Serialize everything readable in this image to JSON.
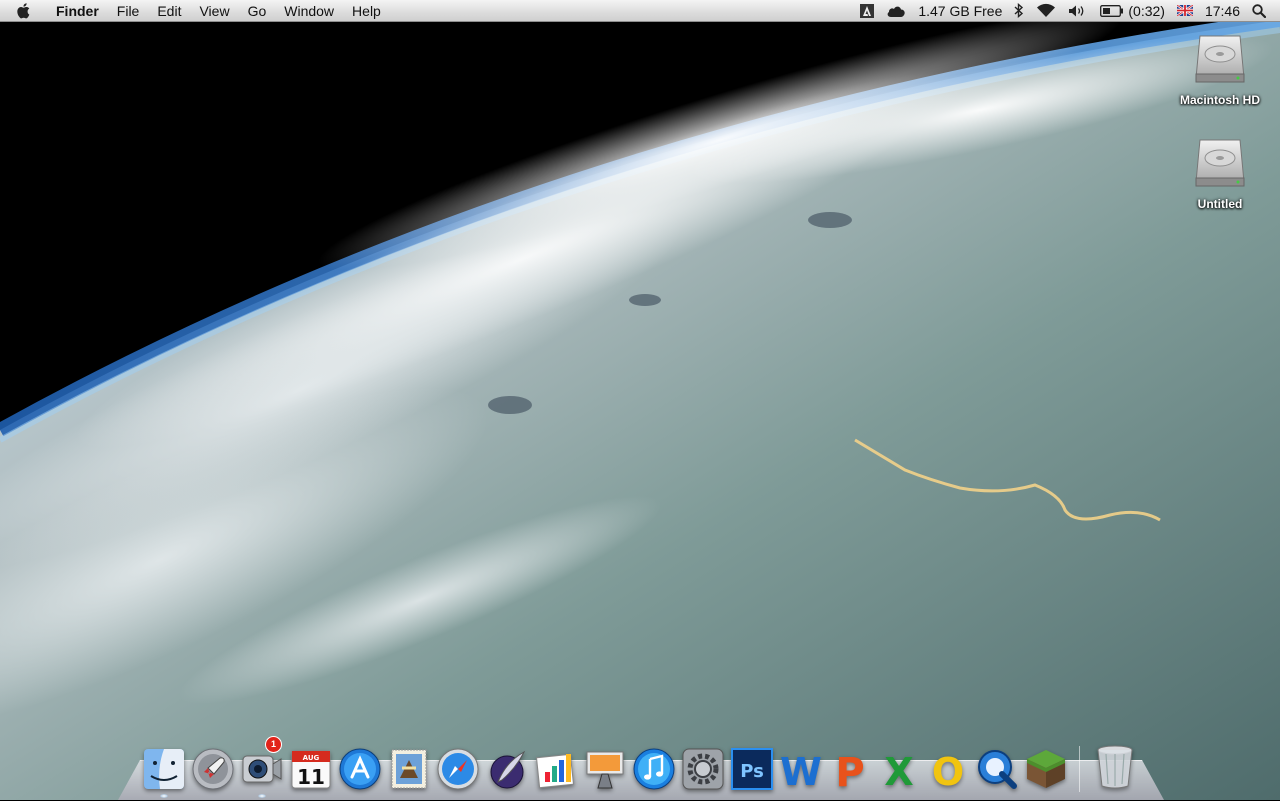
{
  "menubar": {
    "apple_icon": "apple-logo-icon",
    "app_name": "Finder",
    "menus": [
      "File",
      "Edit",
      "View",
      "Go",
      "Window",
      "Help"
    ],
    "status": {
      "adobe_icon": "adobe-icon",
      "icloud_icon": "cloud-icon",
      "disk_free": "1.47 GB Free",
      "bluetooth_icon": "bluetooth-icon",
      "wifi_icon": "wifi-icon",
      "volume_icon": "volume-icon",
      "battery_time": "(0:32)",
      "input_flag_icon": "uk-flag-icon",
      "clock": "17:46",
      "spotlight_icon": "search-icon"
    }
  },
  "desktop": {
    "icons": [
      {
        "label": "Macintosh HD",
        "icon": "hard-drive-icon"
      },
      {
        "label": "Untitled",
        "icon": "hard-drive-icon"
      }
    ]
  },
  "dock": {
    "apps": [
      {
        "name": "Finder",
        "icon": "finder-icon",
        "running": true
      },
      {
        "name": "Launchpad",
        "icon": "rocket-icon",
        "running": false
      },
      {
        "name": "FaceTime",
        "icon": "facetime-camera-icon",
        "running": true,
        "badge": "1"
      },
      {
        "name": "Calendar",
        "icon": "calendar-icon",
        "running": false,
        "month": "AUG",
        "day": "11"
      },
      {
        "name": "App Store",
        "icon": "app-store-icon",
        "running": false
      },
      {
        "name": "Mail",
        "icon": "mail-stamp-icon",
        "running": false
      },
      {
        "name": "Safari",
        "icon": "compass-icon",
        "running": false
      },
      {
        "name": "Script Editor",
        "icon": "quill-icon",
        "running": false
      },
      {
        "name": "Grapher",
        "icon": "chart-icon",
        "running": false
      },
      {
        "name": "Keynote",
        "icon": "keynote-podium-icon",
        "running": false
      },
      {
        "name": "iTunes",
        "icon": "music-note-icon",
        "running": false
      },
      {
        "name": "System Preferences",
        "icon": "gear-icon",
        "running": false
      },
      {
        "name": "Photoshop",
        "icon": "photoshop-icon",
        "running": false,
        "glyph": "Ps"
      },
      {
        "name": "Word",
        "icon": "word-icon",
        "running": false,
        "glyph": "W"
      },
      {
        "name": "PowerPoint",
        "icon": "powerpoint-icon",
        "running": false,
        "glyph": "P"
      },
      {
        "name": "Excel",
        "icon": "excel-icon",
        "running": false,
        "glyph": "X"
      },
      {
        "name": "Outlook",
        "icon": "outlook-icon",
        "running": false,
        "glyph": "O"
      },
      {
        "name": "QuickTime",
        "icon": "quicktime-icon",
        "running": false
      },
      {
        "name": "Minecraft",
        "icon": "grass-block-icon",
        "running": false
      }
    ],
    "trash": {
      "name": "Trash",
      "icon": "trash-icon"
    }
  },
  "colors": {
    "menubar_top": "#f4f4f4",
    "menubar_bottom": "#cfcfcf",
    "badge_red": "#e2231a",
    "ps_blue": "#0b2a5c",
    "word_blue": "#1c6fd1",
    "powerpoint_orange": "#e8521b",
    "excel_green": "#1f9a38",
    "outlook_yellow": "#f1c40f"
  }
}
